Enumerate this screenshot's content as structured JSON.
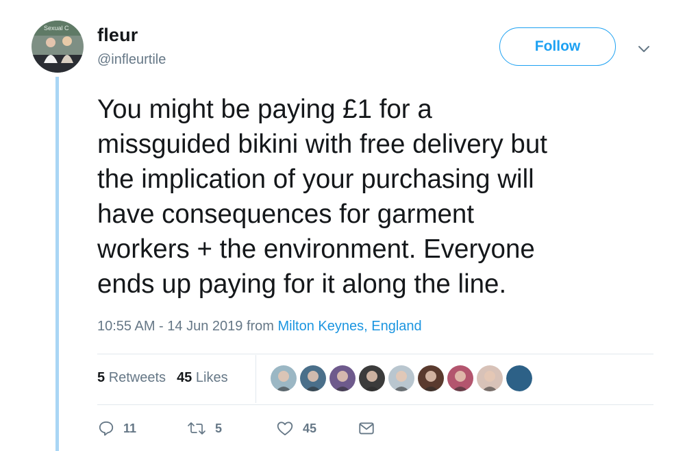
{
  "user": {
    "display_name": "fleur",
    "handle": "@infleurtile",
    "avatar_text": "Sexual C"
  },
  "follow_label": "Follow",
  "tweet": {
    "text": "You might be paying £1 for a\nmissguided bikini with free delivery but\nthe implication of your purchasing will\nhave consequences for garment\nworkers + the environment. Everyone\nends up paying for it along the line.",
    "time": "10:55 AM - 14 Jun 2019",
    "from_word": "from",
    "location": "Milton Keynes, England"
  },
  "stats": {
    "retweets_count": "5",
    "retweets_label": "Retweets",
    "likes_count": "45",
    "likes_label": "Likes"
  },
  "likers": [
    {
      "name": "liker-avatar-1",
      "color": "#9bb7c4"
    },
    {
      "name": "liker-avatar-2",
      "color": "#4a6f8a"
    },
    {
      "name": "liker-avatar-3",
      "color": "#6e5a8c"
    },
    {
      "name": "liker-avatar-4",
      "color": "#3b3b3b"
    },
    {
      "name": "liker-avatar-5",
      "color": "#b9c6cf"
    },
    {
      "name": "liker-avatar-6",
      "color": "#5a3a2e"
    },
    {
      "name": "liker-avatar-7",
      "color": "#b3556e"
    },
    {
      "name": "liker-avatar-8",
      "color": "#d8c2b8"
    },
    {
      "name": "liker-avatar-9",
      "color": "#2d6187"
    }
  ],
  "actions": {
    "reply_count": "11",
    "retweet_count": "5",
    "like_count": "45"
  },
  "colors": {
    "accent": "#1da1f2",
    "link": "#1b95e0",
    "thread_line": "#a9d6f5",
    "muted": "#657786"
  },
  "icons": [
    "reply-icon",
    "retweet-icon",
    "heart-icon",
    "mail-icon",
    "chevron-down-icon"
  ]
}
